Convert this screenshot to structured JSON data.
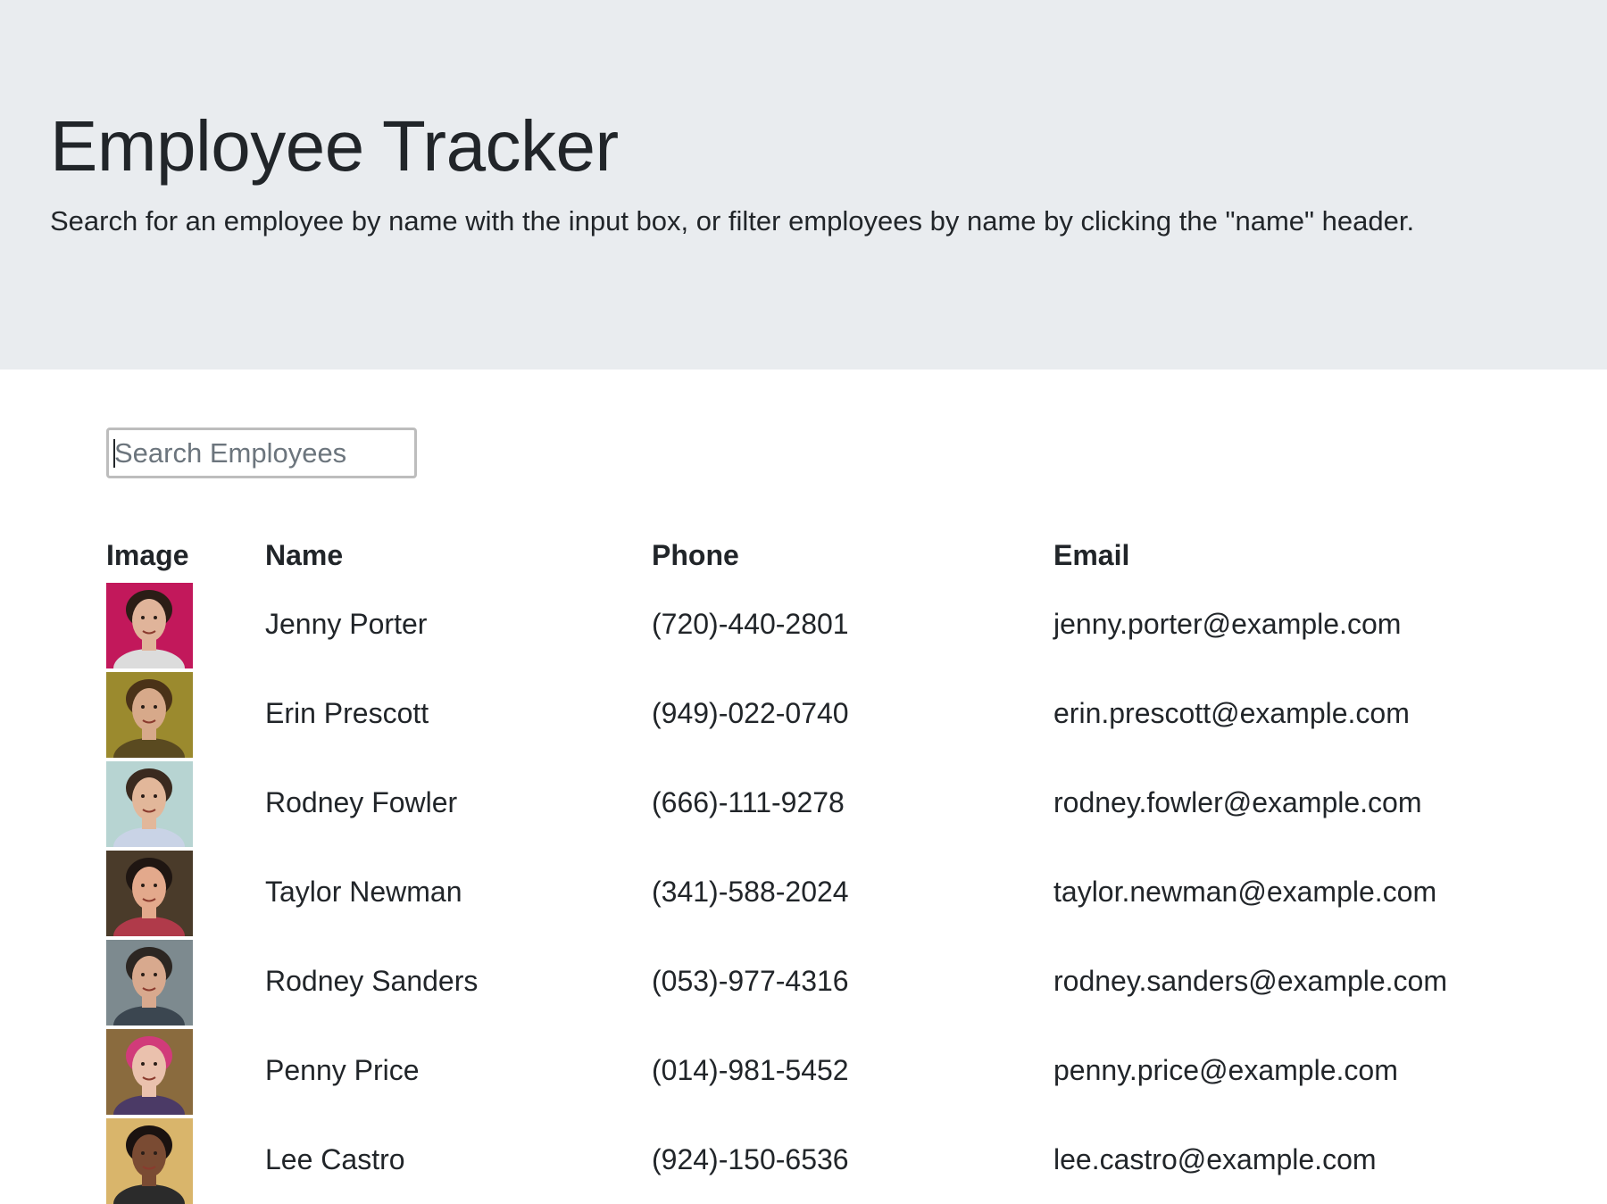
{
  "header": {
    "title": "Employee Tracker",
    "subtitle": "Search for an employee by name with the input box, or filter employees by name by clicking the \"name\" header."
  },
  "search": {
    "placeholder": "Search Employees",
    "value": ""
  },
  "table": {
    "columns": [
      "Image",
      "Name",
      "Phone",
      "Email"
    ],
    "rows": [
      {
        "name": "Jenny Porter",
        "phone": "(720)-440-2801",
        "email": "jenny.porter@example.com",
        "bg": "#c2185b",
        "skin": "#e0b49a",
        "hair": "#2b1d16",
        "shirt": "#dcdcdc"
      },
      {
        "name": "Erin Prescott",
        "phone": "(949)-022-0740",
        "email": "erin.prescott@example.com",
        "bg": "#9b8a2e",
        "skin": "#d7a98a",
        "hair": "#4a3218",
        "shirt": "#5a4a20"
      },
      {
        "name": "Rodney Fowler",
        "phone": "(666)-111-9278",
        "email": "rodney.fowler@example.com",
        "bg": "#b7d4d2",
        "skin": "#e2b79a",
        "hair": "#3a2a1f",
        "shirt": "#c9d3e6"
      },
      {
        "name": "Taylor Newman",
        "phone": "(341)-588-2024",
        "email": "taylor.newman@example.com",
        "bg": "#4a3b2a",
        "skin": "#e3a98c",
        "hair": "#1f1612",
        "shirt": "#b03a4a"
      },
      {
        "name": "Rodney Sanders",
        "phone": "(053)-977-4316",
        "email": "rodney.sanders@example.com",
        "bg": "#7d8a8f",
        "skin": "#d8a98e",
        "hair": "#2c2622",
        "shirt": "#3b4650"
      },
      {
        "name": "Penny Price",
        "phone": "(014)-981-5452",
        "email": "penny.price@example.com",
        "bg": "#8a6b3e",
        "skin": "#eac1ad",
        "hair": "#d13b7a",
        "shirt": "#4b3a66"
      },
      {
        "name": "Lee Castro",
        "phone": "(924)-150-6536",
        "email": "lee.castro@example.com",
        "bg": "#d9b56b",
        "skin": "#7a4b33",
        "hair": "#1a1210",
        "shirt": "#2b2b2b"
      }
    ]
  }
}
